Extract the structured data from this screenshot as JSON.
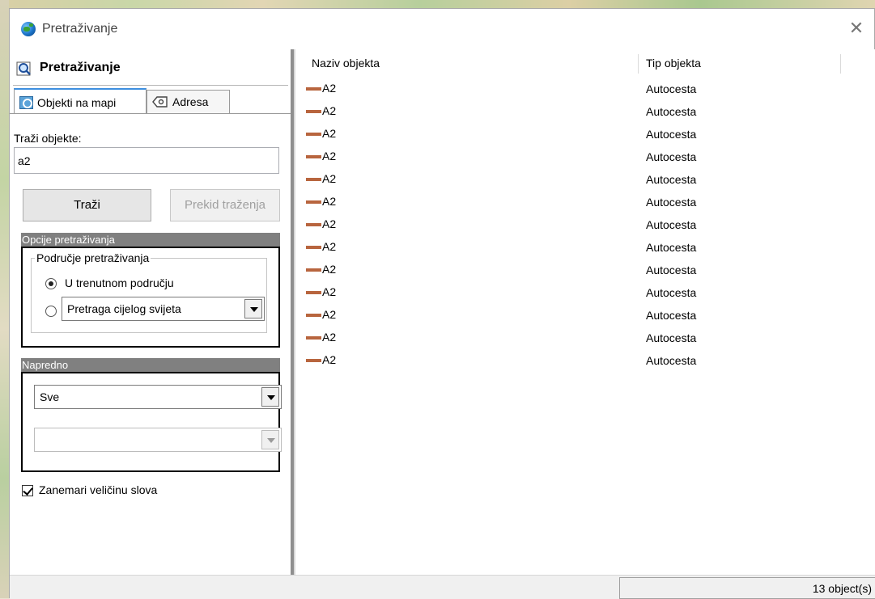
{
  "window": {
    "title": "Pretraživanje",
    "close_glyph": "✕"
  },
  "left_panel": {
    "header": "Pretraživanje",
    "tabs": [
      {
        "label": "Objekti na mapi",
        "icon": "map-search-icon",
        "selected": true
      },
      {
        "label": "Adresa",
        "icon": "address-tag-icon",
        "selected": false
      }
    ],
    "search_label": "Traži objekte:",
    "search_value": "a2",
    "search_button": "Traži",
    "stop_button": "Prekid traženja",
    "options_title": "Opcije pretraživanja",
    "area_group": "Područje pretraživanja",
    "radio_current": "U trenutnom području",
    "radio_world_combo": "Pretraga cijelog svijeta",
    "advanced_title": "Napredno",
    "advanced_combo1": "Sve",
    "advanced_combo2": "",
    "ignore_case_label": "Zanemari veličinu slova",
    "ignore_case_checked": true
  },
  "results": {
    "columns": [
      "Naziv objekta",
      "Tip objekta"
    ],
    "line_color": "#b8653e",
    "rows": [
      {
        "name": "A2",
        "type": "Autocesta"
      },
      {
        "name": "A2",
        "type": "Autocesta"
      },
      {
        "name": "A2",
        "type": "Autocesta"
      },
      {
        "name": "A2",
        "type": "Autocesta"
      },
      {
        "name": "A2",
        "type": "Autocesta"
      },
      {
        "name": "A2",
        "type": "Autocesta"
      },
      {
        "name": "A2",
        "type": "Autocesta"
      },
      {
        "name": "A2",
        "type": "Autocesta"
      },
      {
        "name": "A2",
        "type": "Autocesta"
      },
      {
        "name": "A2",
        "type": "Autocesta"
      },
      {
        "name": "A2",
        "type": "Autocesta"
      },
      {
        "name": "A2",
        "type": "Autocesta"
      },
      {
        "name": "A2",
        "type": "Autocesta"
      }
    ]
  },
  "status": {
    "count_text": "13 object(s)"
  }
}
